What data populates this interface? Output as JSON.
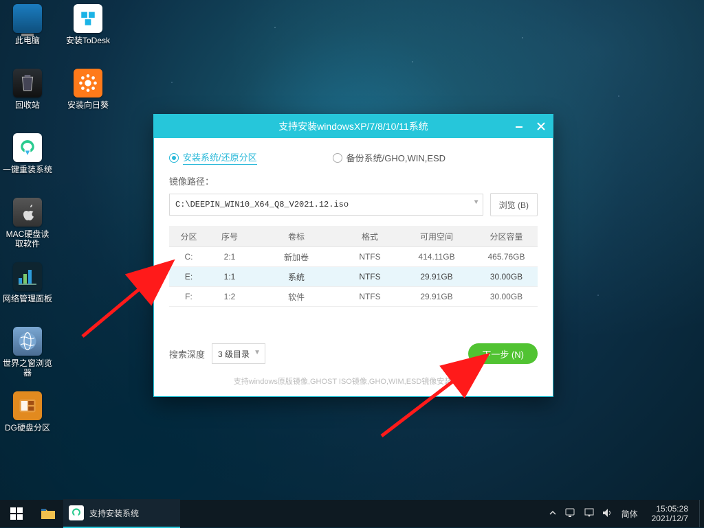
{
  "desktop_icons": {
    "this_pc": "此电脑",
    "todesk": "安装ToDesk",
    "recycle": "回收站",
    "sunflower": "安装向日葵",
    "reinstall": "一键重装系统",
    "mac_read": "MAC硬盘读取软件",
    "net_panel": "网络管理面板",
    "world_browser": "世界之窗浏览器",
    "dg_part": "DG硬盘分区"
  },
  "window": {
    "title": "支持安装windowsXP/7/8/10/11系统",
    "tab_install": "安装系统/还原分区",
    "tab_backup": "备份系统/GHO,WIN,ESD",
    "image_path_label": "镜像路径：",
    "image_path_value": "C:\\DEEPIN_WIN10_X64_Q8_V2021.12.iso",
    "browse_label": "浏览 (B)",
    "table_headers": [
      "分区",
      "序号",
      "卷标",
      "格式",
      "可用空间",
      "分区容量"
    ],
    "rows": [
      {
        "drive": "C:",
        "idx": "2:1",
        "label": "新加卷",
        "fmt": "NTFS",
        "free": "414.11GB",
        "total": "465.76GB"
      },
      {
        "drive": "E:",
        "idx": "1:1",
        "label": "系统",
        "fmt": "NTFS",
        "free": "29.91GB",
        "total": "30.00GB"
      },
      {
        "drive": "F:",
        "idx": "1:2",
        "label": "软件",
        "fmt": "NTFS",
        "free": "29.91GB",
        "total": "30.00GB"
      }
    ],
    "depth_label": "搜索深度",
    "depth_value": "3 级目录",
    "next_label": "下一步 (N)",
    "footnote": "支持windows原版镜像,GHOST ISO镜像,GHO,WIM,ESD镜像安装 V11.0"
  },
  "taskbar": {
    "task_label": "支持安装系统",
    "ime": "简体",
    "time": "15:05:28",
    "date": "2021/12/7"
  }
}
